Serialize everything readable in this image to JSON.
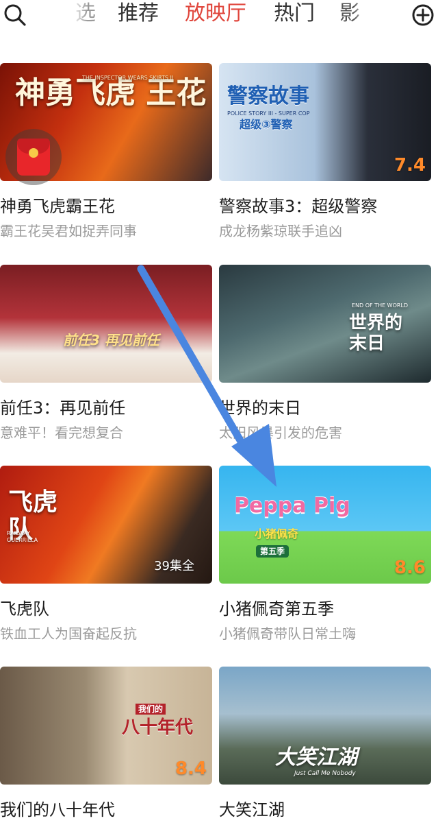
{
  "nav": {
    "tabs": [
      "选",
      "推荐",
      "放映厅",
      "热门",
      "影"
    ],
    "active_tab": "放映厅",
    "accent_color": "#e0463c"
  },
  "icons": {
    "search": "search-icon",
    "add": "plus-circle-icon",
    "red_packet": "red-envelope-icon"
  },
  "cards": [
    {
      "title": "神勇飞虎霸王花",
      "subtitle": "霸王花吴君如捉弄同事",
      "poster_text": "神勇飞虎 王花",
      "poster_small_text": "THE INSPECTOR WEARS SKIRTS II",
      "red_packet_symbol": "¥"
    },
    {
      "title": "警察故事3：超级警察",
      "subtitle": "成龙杨紫琼联手追凶",
      "poster_text": "警察故事",
      "poster_small_text": "POLICE STORY III - SUPER COP",
      "poster_text_2": "超级③警察",
      "score": "7.4"
    },
    {
      "title": "前任3：再见前任",
      "subtitle": "意难平！看完想复合",
      "poster_text": "前任3 再见前任"
    },
    {
      "title": "世界的末日",
      "subtitle": "太阳风暴引发的危害",
      "poster_text": "世界的 末日",
      "poster_small_text": "END OF THE WORLD"
    },
    {
      "title": "飞虎队",
      "subtitle": "铁血工人为国奋起反抗",
      "poster_text": "飞虎 队",
      "poster_small_text": "RAILWAY GUERRILLA",
      "badge": "39集全"
    },
    {
      "title": "小猪佩奇第五季",
      "subtitle": "小猪佩奇带队日常土嗨",
      "poster_text": "Peppa Pig",
      "poster_small_text": "小猪佩奇",
      "poster_text_2": "第五季",
      "score": "8.6"
    },
    {
      "title": "我们的八十年代",
      "subtitle": "",
      "poster_text": "八十年代",
      "poster_small_text": "我们的",
      "score": "8.4"
    },
    {
      "title": "大笑江湖",
      "subtitle": "",
      "poster_text": "大笑江湖",
      "poster_small_text": "Just Call Me Nobody"
    }
  ],
  "annotation": {
    "arrow_color": "#4a86e0"
  }
}
